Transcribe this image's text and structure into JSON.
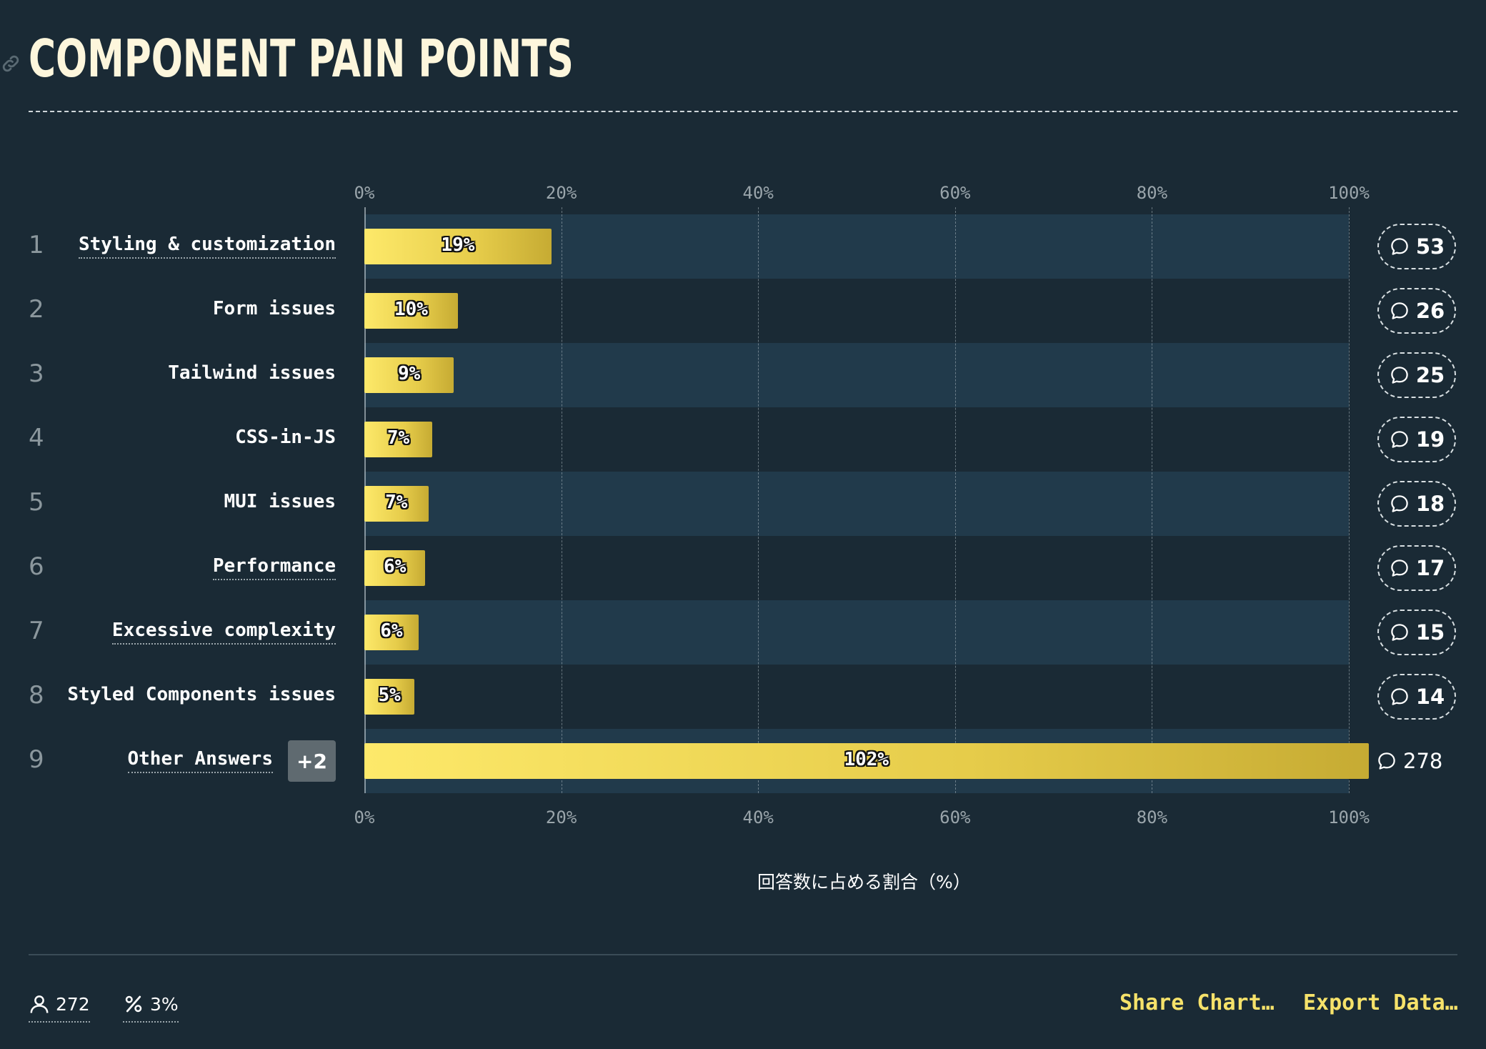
{
  "header": {
    "title": "COMPONENT PAIN POINTS"
  },
  "axis": {
    "ticks": [
      "0%",
      "20%",
      "40%",
      "60%",
      "80%",
      "100%"
    ],
    "x_title": "回答数に占める割合（%）"
  },
  "chart_data": {
    "type": "bar",
    "orientation": "horizontal",
    "xlabel": "回答数に占める割合（%）",
    "xlim": [
      0,
      100
    ],
    "grid": true,
    "rows": [
      {
        "rank": "1",
        "label": "Styling & customization",
        "percent": 19,
        "percent_label": "19%",
        "count": "53",
        "dotted": true
      },
      {
        "rank": "2",
        "label": "Form issues",
        "percent": 9.5,
        "percent_label": "10%",
        "count": "26",
        "dotted": false
      },
      {
        "rank": "3",
        "label": "Tailwind issues",
        "percent": 9.1,
        "percent_label": "9%",
        "count": "25",
        "dotted": false
      },
      {
        "rank": "4",
        "label": "CSS-in-JS",
        "percent": 6.9,
        "percent_label": "7%",
        "count": "19",
        "dotted": false
      },
      {
        "rank": "5",
        "label": "MUI issues",
        "percent": 6.5,
        "percent_label": "7%",
        "count": "18",
        "dotted": false
      },
      {
        "rank": "6",
        "label": "Performance",
        "percent": 6.2,
        "percent_label": "6%",
        "count": "17",
        "dotted": true
      },
      {
        "rank": "7",
        "label": "Excessive complexity",
        "percent": 5.5,
        "percent_label": "6%",
        "count": "15",
        "dotted": true
      },
      {
        "rank": "8",
        "label": "Styled Components issues",
        "percent": 5.1,
        "percent_label": "5%",
        "count": "14",
        "dotted": false
      },
      {
        "rank": "9",
        "label": "Other Answers",
        "percent": 102,
        "percent_label": "102%",
        "count": "278",
        "dotted": true,
        "badge": "+2"
      }
    ]
  },
  "footer": {
    "respondents": "272",
    "percent_stat": "3%",
    "share_label": "Share Chart…",
    "export_label": "Export Data…"
  },
  "colors": {
    "background": "#1a2a35",
    "band": "#213a4b",
    "bar_start": "#fde96a",
    "bar_end": "#c6ab33",
    "accent": "#f6e26a"
  }
}
